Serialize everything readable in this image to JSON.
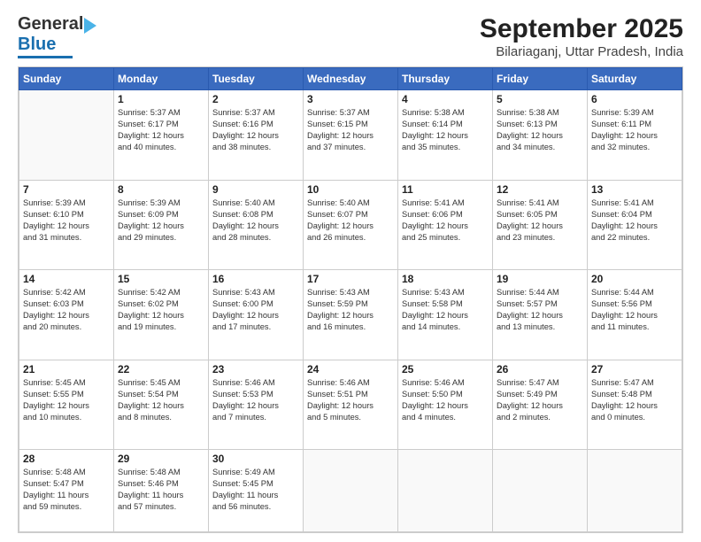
{
  "header": {
    "logo_line1": "General",
    "logo_line2": "Blue",
    "title": "September 2025",
    "subtitle": "Bilariaganj, Uttar Pradesh, India"
  },
  "calendar": {
    "days_of_week": [
      "Sunday",
      "Monday",
      "Tuesday",
      "Wednesday",
      "Thursday",
      "Friday",
      "Saturday"
    ],
    "weeks": [
      [
        {
          "day": "",
          "detail": ""
        },
        {
          "day": "1",
          "detail": "Sunrise: 5:37 AM\nSunset: 6:17 PM\nDaylight: 12 hours\nand 40 minutes."
        },
        {
          "day": "2",
          "detail": "Sunrise: 5:37 AM\nSunset: 6:16 PM\nDaylight: 12 hours\nand 38 minutes."
        },
        {
          "day": "3",
          "detail": "Sunrise: 5:37 AM\nSunset: 6:15 PM\nDaylight: 12 hours\nand 37 minutes."
        },
        {
          "day": "4",
          "detail": "Sunrise: 5:38 AM\nSunset: 6:14 PM\nDaylight: 12 hours\nand 35 minutes."
        },
        {
          "day": "5",
          "detail": "Sunrise: 5:38 AM\nSunset: 6:13 PM\nDaylight: 12 hours\nand 34 minutes."
        },
        {
          "day": "6",
          "detail": "Sunrise: 5:39 AM\nSunset: 6:11 PM\nDaylight: 12 hours\nand 32 minutes."
        }
      ],
      [
        {
          "day": "7",
          "detail": "Sunrise: 5:39 AM\nSunset: 6:10 PM\nDaylight: 12 hours\nand 31 minutes."
        },
        {
          "day": "8",
          "detail": "Sunrise: 5:39 AM\nSunset: 6:09 PM\nDaylight: 12 hours\nand 29 minutes."
        },
        {
          "day": "9",
          "detail": "Sunrise: 5:40 AM\nSunset: 6:08 PM\nDaylight: 12 hours\nand 28 minutes."
        },
        {
          "day": "10",
          "detail": "Sunrise: 5:40 AM\nSunset: 6:07 PM\nDaylight: 12 hours\nand 26 minutes."
        },
        {
          "day": "11",
          "detail": "Sunrise: 5:41 AM\nSunset: 6:06 PM\nDaylight: 12 hours\nand 25 minutes."
        },
        {
          "day": "12",
          "detail": "Sunrise: 5:41 AM\nSunset: 6:05 PM\nDaylight: 12 hours\nand 23 minutes."
        },
        {
          "day": "13",
          "detail": "Sunrise: 5:41 AM\nSunset: 6:04 PM\nDaylight: 12 hours\nand 22 minutes."
        }
      ],
      [
        {
          "day": "14",
          "detail": "Sunrise: 5:42 AM\nSunset: 6:03 PM\nDaylight: 12 hours\nand 20 minutes."
        },
        {
          "day": "15",
          "detail": "Sunrise: 5:42 AM\nSunset: 6:02 PM\nDaylight: 12 hours\nand 19 minutes."
        },
        {
          "day": "16",
          "detail": "Sunrise: 5:43 AM\nSunset: 6:00 PM\nDaylight: 12 hours\nand 17 minutes."
        },
        {
          "day": "17",
          "detail": "Sunrise: 5:43 AM\nSunset: 5:59 PM\nDaylight: 12 hours\nand 16 minutes."
        },
        {
          "day": "18",
          "detail": "Sunrise: 5:43 AM\nSunset: 5:58 PM\nDaylight: 12 hours\nand 14 minutes."
        },
        {
          "day": "19",
          "detail": "Sunrise: 5:44 AM\nSunset: 5:57 PM\nDaylight: 12 hours\nand 13 minutes."
        },
        {
          "day": "20",
          "detail": "Sunrise: 5:44 AM\nSunset: 5:56 PM\nDaylight: 12 hours\nand 11 minutes."
        }
      ],
      [
        {
          "day": "21",
          "detail": "Sunrise: 5:45 AM\nSunset: 5:55 PM\nDaylight: 12 hours\nand 10 minutes."
        },
        {
          "day": "22",
          "detail": "Sunrise: 5:45 AM\nSunset: 5:54 PM\nDaylight: 12 hours\nand 8 minutes."
        },
        {
          "day": "23",
          "detail": "Sunrise: 5:46 AM\nSunset: 5:53 PM\nDaylight: 12 hours\nand 7 minutes."
        },
        {
          "day": "24",
          "detail": "Sunrise: 5:46 AM\nSunset: 5:51 PM\nDaylight: 12 hours\nand 5 minutes."
        },
        {
          "day": "25",
          "detail": "Sunrise: 5:46 AM\nSunset: 5:50 PM\nDaylight: 12 hours\nand 4 minutes."
        },
        {
          "day": "26",
          "detail": "Sunrise: 5:47 AM\nSunset: 5:49 PM\nDaylight: 12 hours\nand 2 minutes."
        },
        {
          "day": "27",
          "detail": "Sunrise: 5:47 AM\nSunset: 5:48 PM\nDaylight: 12 hours\nand 0 minutes."
        }
      ],
      [
        {
          "day": "28",
          "detail": "Sunrise: 5:48 AM\nSunset: 5:47 PM\nDaylight: 11 hours\nand 59 minutes."
        },
        {
          "day": "29",
          "detail": "Sunrise: 5:48 AM\nSunset: 5:46 PM\nDaylight: 11 hours\nand 57 minutes."
        },
        {
          "day": "30",
          "detail": "Sunrise: 5:49 AM\nSunset: 5:45 PM\nDaylight: 11 hours\nand 56 minutes."
        },
        {
          "day": "",
          "detail": ""
        },
        {
          "day": "",
          "detail": ""
        },
        {
          "day": "",
          "detail": ""
        },
        {
          "day": "",
          "detail": ""
        }
      ]
    ]
  }
}
